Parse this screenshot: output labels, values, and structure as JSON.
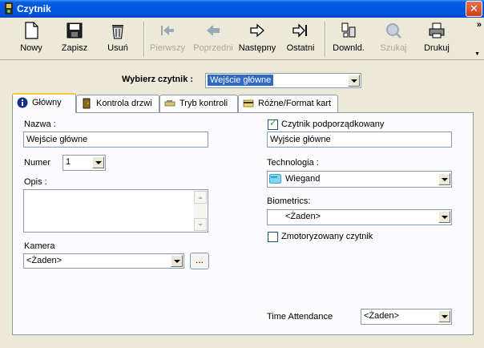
{
  "window": {
    "title": "Czytnik",
    "close_glyph": "✕"
  },
  "toolbar": {
    "buttons": [
      {
        "label": "Nowy",
        "icon": "new-document-icon",
        "enabled": true
      },
      {
        "label": "Zapisz",
        "icon": "save-disk-icon",
        "enabled": true
      },
      {
        "label": "Usuń",
        "icon": "trash-bin-icon",
        "enabled": true
      },
      {
        "label": "Pierwszy",
        "icon": "first-record-icon",
        "enabled": false
      },
      {
        "label": "Poprzedni",
        "icon": "previous-record-icon",
        "enabled": false
      },
      {
        "label": "Następny",
        "icon": "next-record-icon",
        "enabled": true
      },
      {
        "label": "Ostatni",
        "icon": "last-record-icon",
        "enabled": true
      },
      {
        "label": "Downld.",
        "icon": "download-icon",
        "enabled": true
      },
      {
        "label": "Szukaj",
        "icon": "search-icon",
        "enabled": false
      },
      {
        "label": "Drukuj",
        "icon": "printer-icon",
        "enabled": true
      }
    ],
    "more_glyph": "»",
    "scroll_glyph": "▼"
  },
  "reader_selector": {
    "label": "Wybierz czytnik :",
    "value": "Wejście główne"
  },
  "tabs": [
    {
      "label": "Główny",
      "icon": "info-icon",
      "active": true
    },
    {
      "label": "Kontrola drzwi",
      "icon": "door-icon",
      "active": false
    },
    {
      "label": "Tryb kontroli",
      "icon": "card-swipe-icon",
      "active": false
    },
    {
      "label": "Różne/Format kart",
      "icon": "card-format-icon",
      "active": false
    }
  ],
  "form": {
    "name_label": "Nazwa :",
    "name_value": "Wejście główne",
    "number_label": "Numer",
    "number_value": "1",
    "description_label": "Opis :",
    "description_value": "",
    "camera_label": "Kamera",
    "camera_value": "<Żaden>",
    "camera_browse_label": "...",
    "subordinate_label": "Czytnik podporządkowany",
    "subordinate_checked": true,
    "subordinate_value": "Wyjście główne",
    "technology_label": "Technologia :",
    "technology_value": "Wiegand",
    "biometrics_label": "Biometrics:",
    "biometrics_value": "<Żaden>",
    "motorized_label": "Zmotoryzowany czytnik",
    "motorized_checked": false,
    "time_attendance_label": "Time Attendance",
    "time_attendance_value": "<Żaden>"
  },
  "colors": {
    "titlebar": "#0055e5",
    "selection": "#316ac5",
    "background": "#ece9d8",
    "panel": "#fcfcfe",
    "tab_highlight": "#ffc83c"
  }
}
